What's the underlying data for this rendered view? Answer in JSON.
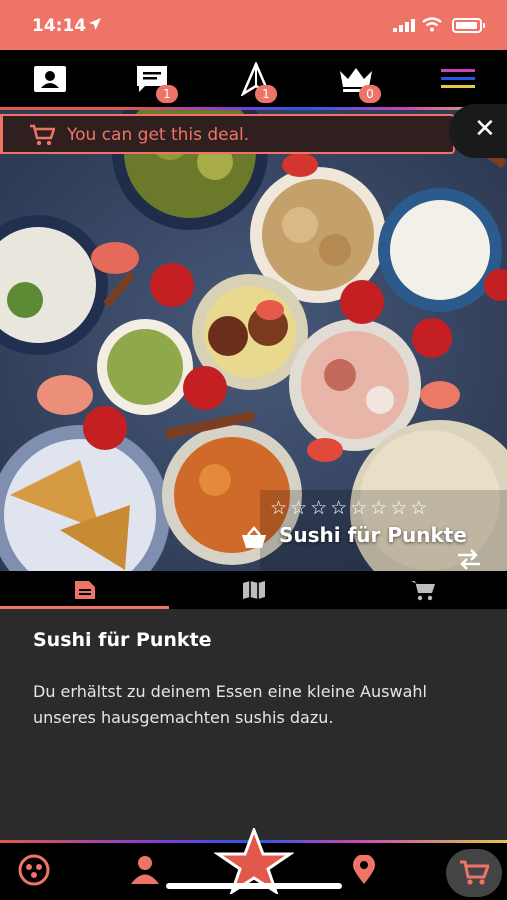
{
  "status_bar": {
    "time": "14:14"
  },
  "top_nav": {
    "items": [
      {
        "icon": "profile-card-icon",
        "badge": ""
      },
      {
        "icon": "chat-icon",
        "badge": "1"
      },
      {
        "icon": "paper-plane-icon",
        "badge": "1"
      },
      {
        "icon": "crown-icon",
        "badge": "0"
      },
      {
        "icon": "menu-icon",
        "badge": ""
      }
    ]
  },
  "deal_banner": {
    "text": "You can get this deal.",
    "close_label": "✕"
  },
  "hero": {
    "rating": "☆☆☆☆☆☆☆☆",
    "title": "Sushi für Punkte"
  },
  "tabs": [
    {
      "icon": "document-icon",
      "active": true
    },
    {
      "icon": "map-icon",
      "active": false
    },
    {
      "icon": "cart-icon",
      "active": false
    }
  ],
  "content": {
    "title": "Sushi für Punkte",
    "description": "Du erhältst zu deinem Essen eine kleine Auswahl unseres hausgemachten sushis dazu."
  },
  "bottom_nav": {
    "items": [
      "coins-icon",
      "user-icon",
      "star-icon",
      "location-pin-icon",
      "cart-icon"
    ]
  },
  "colors": {
    "accent": "#ef7468",
    "nav_bg": "#000000",
    "content_bg": "#2b2b2b"
  }
}
